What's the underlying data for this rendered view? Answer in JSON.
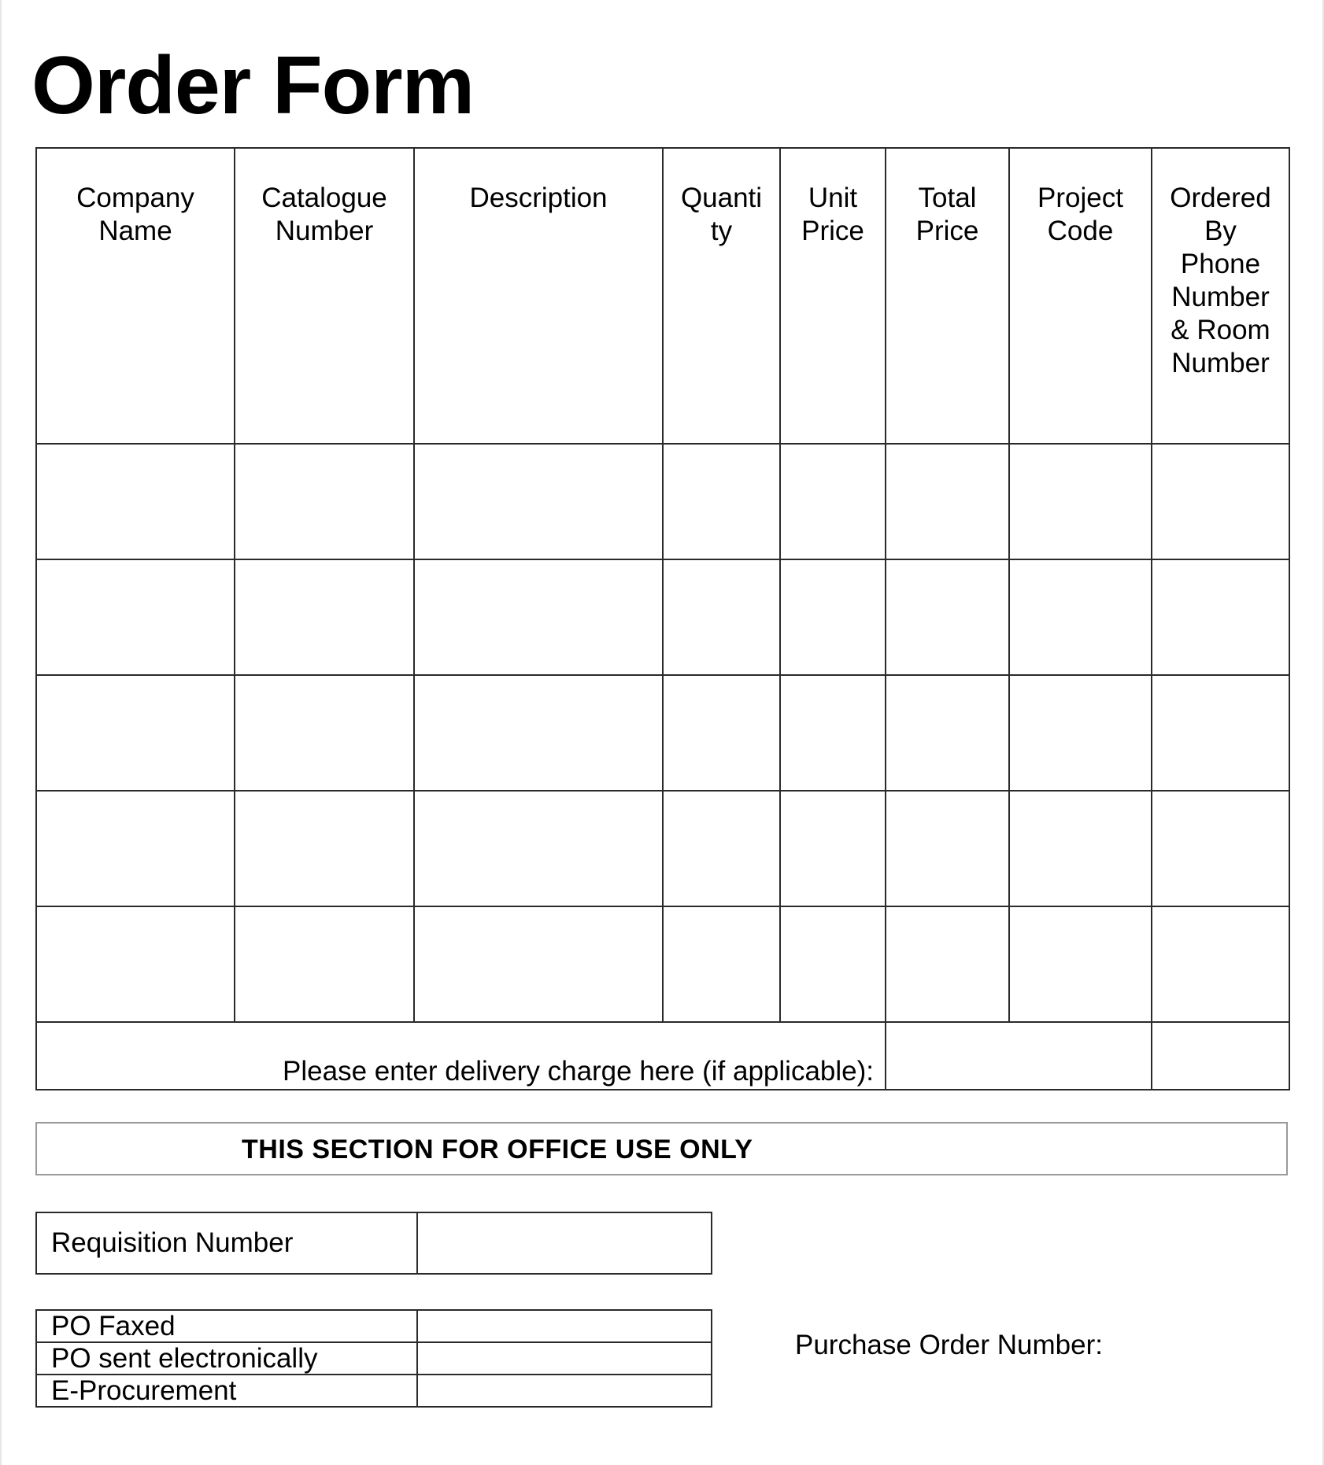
{
  "title": "Order Form",
  "order_table": {
    "headers": [
      "Company Name",
      "Catalogue Number",
      "Description",
      "Quanti ty",
      "Unit Price",
      "Total Price",
      "Project Code",
      "Ordered By Phone Number & Room Number"
    ],
    "rows": [
      [
        "",
        "",
        "",
        "",
        "",
        "",
        "",
        ""
      ],
      [
        "",
        "",
        "",
        "",
        "",
        "",
        "",
        ""
      ],
      [
        "",
        "",
        "",
        "",
        "",
        "",
        "",
        ""
      ],
      [
        "",
        "",
        "",
        "",
        "",
        "",
        "",
        ""
      ],
      [
        "",
        "",
        "",
        "",
        "",
        "",
        "",
        ""
      ]
    ],
    "delivery_label": "Please enter delivery charge here (if applicable):",
    "delivery_charge_value": "",
    "delivery_extra_value": ""
  },
  "office_section": {
    "banner": "THIS SECTION FOR OFFICE USE ONLY",
    "requisition": {
      "label": "Requisition Number",
      "value": ""
    },
    "po_methods": [
      {
        "label": "PO Faxed",
        "value": ""
      },
      {
        "label": "PO sent electronically",
        "value": ""
      },
      {
        "label": "E-Procurement",
        "value": ""
      }
    ],
    "purchase_order_label": "Purchase Order Number:",
    "purchase_order_value": ""
  }
}
